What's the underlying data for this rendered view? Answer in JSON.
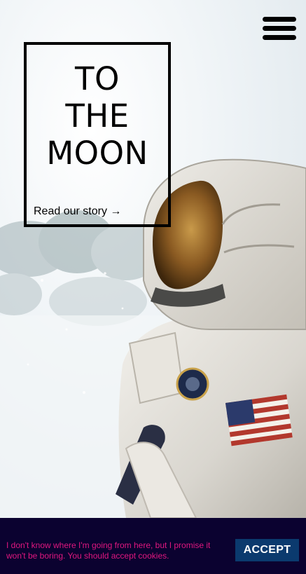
{
  "header": {
    "menu_icon": "hamburger-menu-icon"
  },
  "hero": {
    "title_line1": "TO",
    "title_line2": "THE",
    "title_line3": "MOON",
    "story_link": "Read our story →",
    "image_subject": "astronaut-in-spacesuit"
  },
  "cookie_banner": {
    "message": "I don't know where I'm going from here, but I promise it won't be boring. You should accept cookies.",
    "accept_label": "ACCEPT",
    "colors": {
      "background": "#0b0230",
      "text": "#e0177f",
      "button": "#0b3a6e"
    }
  }
}
